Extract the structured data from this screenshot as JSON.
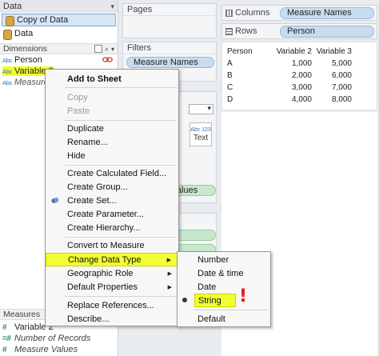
{
  "left_pane": {
    "header": "Data",
    "datasources": [
      "Copy of Data",
      "Data"
    ],
    "dimensions_label": "Dimensions",
    "dimensions": [
      {
        "type": "Abc",
        "name": "Person"
      },
      {
        "type": "Abc",
        "name": "Variable 3"
      },
      {
        "type": "Abc",
        "name": "Measure Names"
      }
    ],
    "measures_label": "Measures",
    "measures": [
      {
        "type": "#",
        "name": "Variable 2"
      },
      {
        "type": "=#",
        "name": "Number of Records"
      },
      {
        "type": "#",
        "name": "Measure Values"
      }
    ]
  },
  "cards": {
    "pages": "Pages",
    "filters": "Filters",
    "filter_pill": "Measure Names",
    "marks_text": "Text",
    "marks_text_abc": "Abc 123",
    "values_pill_partial": "alues"
  },
  "shelves": {
    "columns_label": "Columns",
    "columns_pill": "Measure Names",
    "rows_label": "Rows",
    "rows_pill": "Person"
  },
  "table": {
    "headers": [
      "Person",
      "Variable 2",
      "Variable 3"
    ],
    "rows": [
      [
        "A",
        "1,000",
        "5,000"
      ],
      [
        "B",
        "2,000",
        "6,000"
      ],
      [
        "C",
        "3,000",
        "7,000"
      ],
      [
        "D",
        "4,000",
        "8,000"
      ]
    ]
  },
  "context_menu": {
    "items": [
      "Add to Sheet",
      "Copy",
      "Paste",
      "Duplicate",
      "Rename...",
      "Hide",
      "Create Calculated Field...",
      "Create Group...",
      "Create Set...",
      "Create Parameter...",
      "Create Hierarchy...",
      "Convert to Measure",
      "Change Data Type",
      "Geographic Role",
      "Default Properties",
      "Replace References...",
      "Describe..."
    ]
  },
  "sub_menu": {
    "items": [
      "Number",
      "Date & time",
      "Date",
      "String",
      "Default"
    ],
    "selected": "String"
  },
  "annotation": "!",
  "colors": {
    "highlight": "#f2ff33",
    "pill_blue": "#c9dcef",
    "pill_green": "#c8e7cc",
    "annotation_red": "#e31b1b"
  }
}
